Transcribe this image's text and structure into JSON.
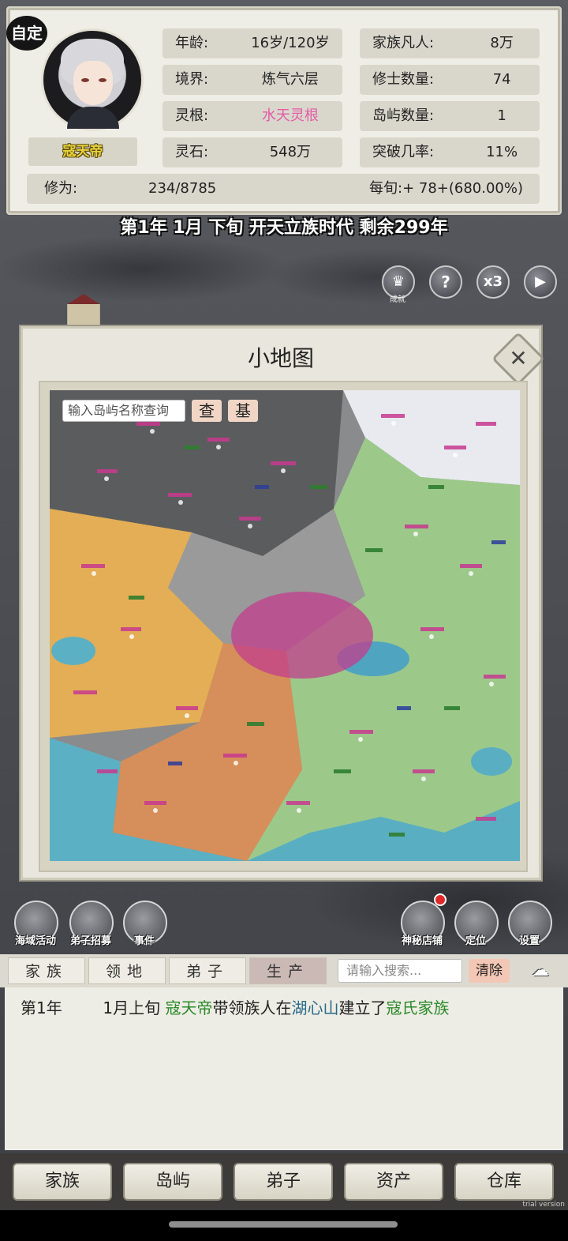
{
  "player": {
    "badge": "自定",
    "name": "寇天帝"
  },
  "stats_left": [
    {
      "label": "年龄:",
      "value": "16岁/120岁"
    },
    {
      "label": "境界:",
      "value": "炼气六层"
    },
    {
      "label": "灵根:",
      "value": "水天灵根"
    },
    {
      "label": "灵石:",
      "value": "548万"
    }
  ],
  "stats_right": [
    {
      "label": "家族凡人:",
      "value": "8万"
    },
    {
      "label": "修士数量:",
      "value": "74"
    },
    {
      "label": "岛屿数量:",
      "value": "1"
    },
    {
      "label": "突破几率:",
      "value": "11%"
    }
  ],
  "cultivation": {
    "label": "修为:",
    "value": "234/8785",
    "rate": "每旬:+ 78+(680.00%)"
  },
  "date_line": "第1年 1月 下旬  开天立族时代 剩余299年",
  "top_buttons": {
    "achievement_label": "成就",
    "help": "?",
    "speed": "x3",
    "play": "▶"
  },
  "minimap": {
    "title": "小地图",
    "close": "✕",
    "search_placeholder": "输入岛屿名称查询",
    "query_btn": "查",
    "base_btn": "基"
  },
  "left_icons": [
    "海域活动",
    "弟子招募",
    "事件"
  ],
  "right_icons": [
    "神秘店铺",
    "定位",
    "设置"
  ],
  "tabs": [
    "家族",
    "领地",
    "弟子",
    "生产"
  ],
  "log_search_placeholder": "请输入搜索...",
  "clear_btn": "清除",
  "log": {
    "year": "第1年",
    "time": "1月上旬",
    "actor": "寇天帝",
    "text1": "带领族人在",
    "place": "湖心山",
    "text2": "建立了",
    "clan": "寇氏家族"
  },
  "nav": [
    "家族",
    "岛屿",
    "弟子",
    "资产",
    "仓库"
  ],
  "watermark": "trial version",
  "colors": {
    "panel": "#efeee6",
    "accent_pink": "#e55aa6",
    "log_green": "#2a8a2a",
    "log_blue": "#2a6a8a"
  }
}
